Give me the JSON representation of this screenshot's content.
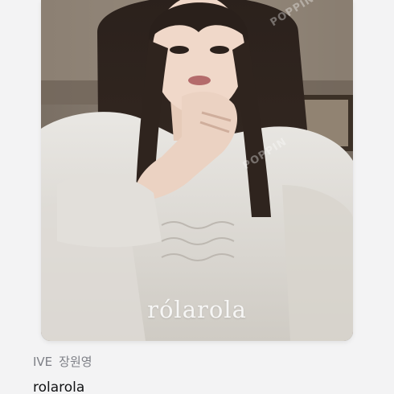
{
  "listing": {
    "photo_logo": "rólarola",
    "watermark": "POPPIN",
    "group": "IVE",
    "member": "장원영",
    "title": "rolarola"
  }
}
